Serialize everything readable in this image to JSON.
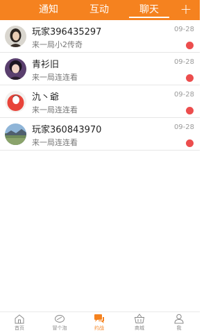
{
  "header": {
    "tabs": [
      {
        "label": "通知"
      },
      {
        "label": "互动"
      },
      {
        "label": "聊天"
      }
    ],
    "active_tab": "聊天",
    "plus_label": "+",
    "accent_color": "#f5821f"
  },
  "conversations": [
    {
      "name": "玩家396435297",
      "message": "来一局小2传奇",
      "date": "09-28",
      "unread": true
    },
    {
      "name": "青衫旧",
      "message": "来一局连连看",
      "date": "09-28",
      "unread": true
    },
    {
      "name": "氿丶爺",
      "message": "来一局连连看",
      "date": "09-28",
      "unread": true
    },
    {
      "name": "玩家360843970",
      "message": "来一局连连看",
      "date": "09-28",
      "unread": true
    }
  ],
  "bottom_nav": {
    "items": [
      {
        "label": "首页",
        "icon": "home-icon"
      },
      {
        "label": "冒个泡",
        "icon": "bubble-icon"
      },
      {
        "label": "约战",
        "icon": "chat-icon"
      },
      {
        "label": "商城",
        "icon": "basket-icon"
      },
      {
        "label": "我",
        "icon": "person-icon"
      }
    ],
    "active": "约战"
  },
  "colors": {
    "unread_dot": "#ec4d4d",
    "divider": "#e6e6e6"
  }
}
